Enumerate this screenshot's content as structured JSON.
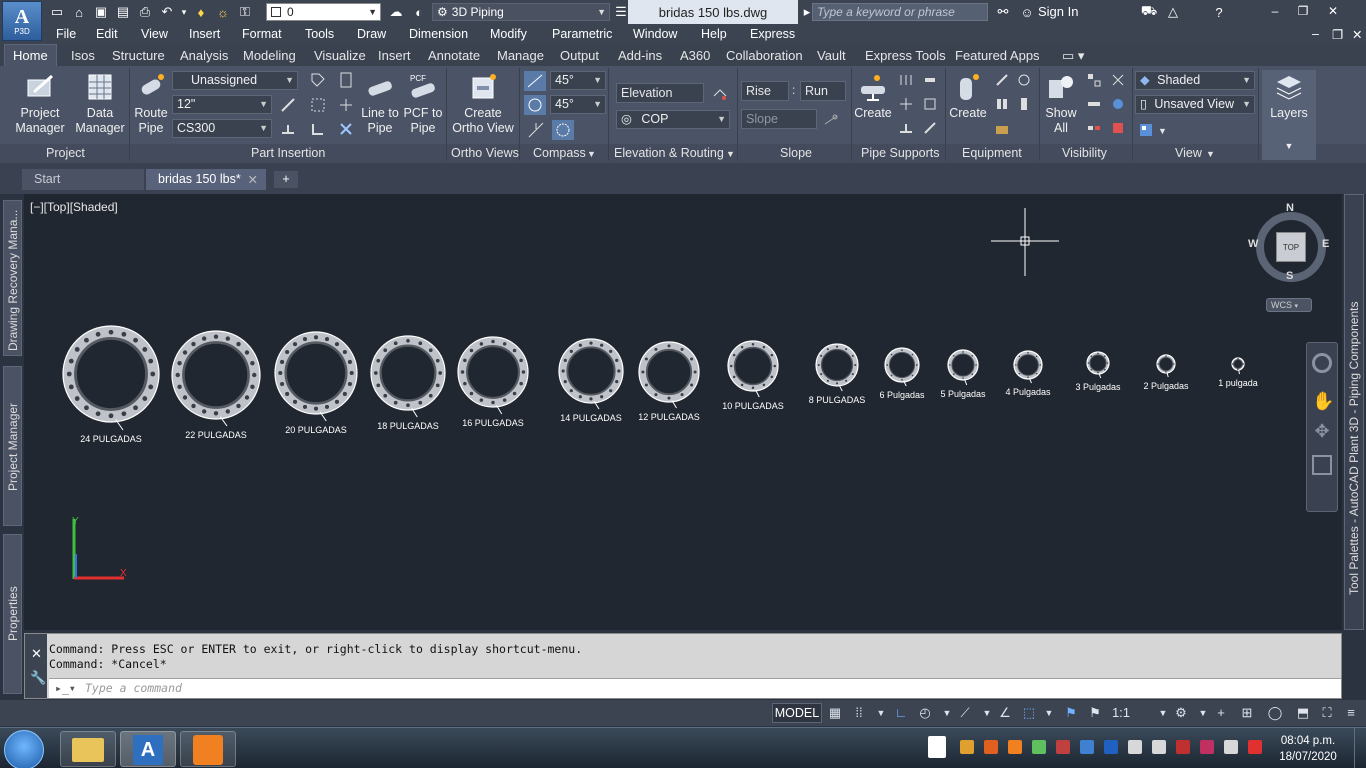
{
  "app": {
    "badge": "P3D",
    "letter": "A"
  },
  "titlebar": {
    "layer_value": "0",
    "workspace": "3D Piping",
    "document_title": "bridas 150 lbs.dwg",
    "search_placeholder": "Type a keyword or phrase",
    "signin": "Sign In"
  },
  "menu": [
    "File",
    "Edit",
    "View",
    "Insert",
    "Format",
    "Tools",
    "Draw",
    "Dimension",
    "Modify",
    "Parametric",
    "Window",
    "Help",
    "Express"
  ],
  "ribbon_tabs": [
    "Home",
    "Isos",
    "Structure",
    "Analysis",
    "Modeling",
    "Visualize",
    "Insert",
    "Annotate",
    "Manage",
    "Output",
    "Add-ins",
    "A360",
    "Collaboration",
    "Vault",
    "Express Tools",
    "Featured Apps"
  ],
  "ribbon": {
    "project": {
      "title": "Project",
      "manager": "Project Manager",
      "data_manager": "Data Manager"
    },
    "part_insertion": {
      "title": "Part Insertion",
      "route_pipe": "Route Pipe",
      "line_type": "Unassigned",
      "size": "12\"",
      "spec": "CS300",
      "line_to_pipe": "Line to Pipe",
      "pcf_to_pipe": "PCF to Pipe",
      "pcf_tag": "PCF"
    },
    "ortho": {
      "title": "Ortho Views",
      "create": "Create Ortho View"
    },
    "compass": {
      "title": "Compass",
      "angle1": "45°",
      "angle2": "45°"
    },
    "elevation": {
      "title": "Elevation & Routing",
      "elevation": "Elevation",
      "cop": "COP"
    },
    "slope": {
      "title": "Slope",
      "rise": "Rise",
      "run": "Run",
      "slope": "Slope",
      "colon": ":"
    },
    "supports": {
      "title": "Pipe Supports",
      "create": "Create"
    },
    "equipment": {
      "title": "Equipment",
      "create": "Create"
    },
    "visibility": {
      "title": "Visibility",
      "show_all": "Show All"
    },
    "view": {
      "title": "View",
      "visual_style": "Shaded",
      "named_view": "Unsaved View"
    },
    "layers": {
      "label": "Layers"
    }
  },
  "doc_tabs": {
    "start": "Start",
    "file": "bridas 150 lbs*",
    "add": "+"
  },
  "side_palettes": {
    "recovery": "Drawing Recovery Mana...",
    "project_manager": "Project Manager",
    "properties": "Properties",
    "tool_palettes": "Tool Palettes - AutoCAD Plant 3D - Piping Components"
  },
  "viewport": {
    "label": "[−][Top][Shaded]",
    "viewcube": {
      "n": "N",
      "s": "S",
      "e": "E",
      "w": "W",
      "face": "TOP",
      "wcs": "WCS"
    }
  },
  "flanges": [
    {
      "label": "24  PULGADAS"
    },
    {
      "label": "22  PULGADAS"
    },
    {
      "label": "20  PULGADAS"
    },
    {
      "label": "18 PULGADAS"
    },
    {
      "label": "16 PULGADAS"
    },
    {
      "label": "14 PULGADAS"
    },
    {
      "label": "12 PULGADAS"
    },
    {
      "label": "10 PULGADAS"
    },
    {
      "label": "8 PULGADAS"
    },
    {
      "label": "6 Pulgadas"
    },
    {
      "label": "5 Pulgadas"
    },
    {
      "label": "4 Pulgadas"
    },
    {
      "label": "3 Pulgadas"
    },
    {
      "label": "2 Pulgadas"
    },
    {
      "label": "1 pulgada"
    }
  ],
  "command": {
    "line1": "Command: Press ESC or ENTER to exit, or right-click to display shortcut-menu.",
    "line2": "Command: *Cancel*",
    "placeholder": "Type a command"
  },
  "status": {
    "model": "MODEL",
    "scale": "1:1"
  },
  "taskbar": {
    "time": "08:04 p.m.",
    "date": "18/07/2020"
  }
}
